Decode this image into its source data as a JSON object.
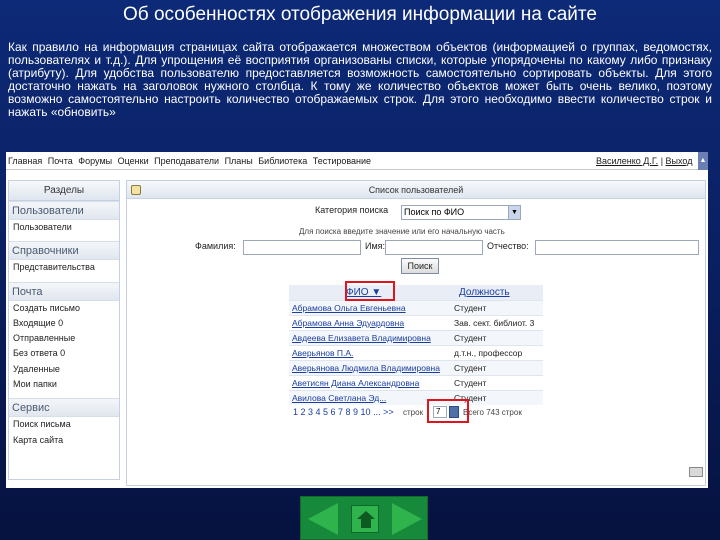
{
  "slide": {
    "title": "Об особенностях отображения информации на сайте",
    "body": "Как правило на информация страницах сайта отображается множеством объектов (информацией о группах, ведомостях, пользователях и т.д.). Для упрощения её восприятия организованы списки, которые упорядочены по какому либо признаку (атрибуту). Для удобства пользователю предоставляется возможность самостоятельно сортировать объекты. Для этого достаточно нажать на заголовок нужного столбца. К тому же количество объектов может быть очень велико, поэтому возможно самостоятельно настроить количество отображаемых строк. Для этого необходимо ввести количество строк и нажать «обновить»"
  },
  "topnav": {
    "links": [
      "Главная",
      "Почта",
      "Форумы",
      "Оценки",
      "Преподаватели",
      "Планы",
      "Библиотека",
      "Тестирование"
    ],
    "user": "Василенко Д.Г.",
    "exit": "Выход"
  },
  "sidebar": {
    "header": "Разделы",
    "sections": [
      {
        "title": "Пользователи",
        "items": [
          "Пользователи"
        ]
      },
      {
        "title": "Справочники",
        "items": [
          "Представительства"
        ]
      },
      {
        "title": "Почта",
        "items": [
          "Создать письмо",
          "Входящие 0",
          "Отправленные",
          "Без ответа 0",
          "Удаленные",
          "Мои папки"
        ]
      },
      {
        "title": "Сервис",
        "items": [
          "Поиск письма",
          "Карта сайта"
        ]
      }
    ]
  },
  "main": {
    "header": "Список пользователей",
    "category_label": "Категория поиска",
    "category_value": "Поиск по ФИО",
    "hint": "Для поиска введите значение или его начальную часть",
    "surname_label": "Фамилия:",
    "name_label": "Имя:",
    "patronymic_label": "Отчество:",
    "search_button": "Поиск",
    "table": {
      "col_fio": "ФИО ▼",
      "col_position": "Должность",
      "rows": [
        {
          "fio": "Абрамова Ольга Евгеньевна",
          "position": "Студент"
        },
        {
          "fio": "Абрамова Анна Эдуардовна",
          "position": "Зав. сект. библиот. 3"
        },
        {
          "fio": "Авдеева Елизавета Владимировна",
          "position": "Студент"
        },
        {
          "fio": "Аверьянов П.А.",
          "position": "д.т.н., профессор"
        },
        {
          "fio": "Аверьянова Людмила Владимировна",
          "position": "Студент"
        },
        {
          "fio": "Аветисян Диана Александровна",
          "position": "Студент"
        },
        {
          "fio": "Авилова Светлана Эд...",
          "position": "Студент"
        }
      ]
    },
    "pager": {
      "pages": "1 2 3 4 5 6 7 8 9 10 ... >>",
      "rows_label": "строк",
      "rows_value": "7",
      "total": "Всего 743 строк"
    }
  }
}
